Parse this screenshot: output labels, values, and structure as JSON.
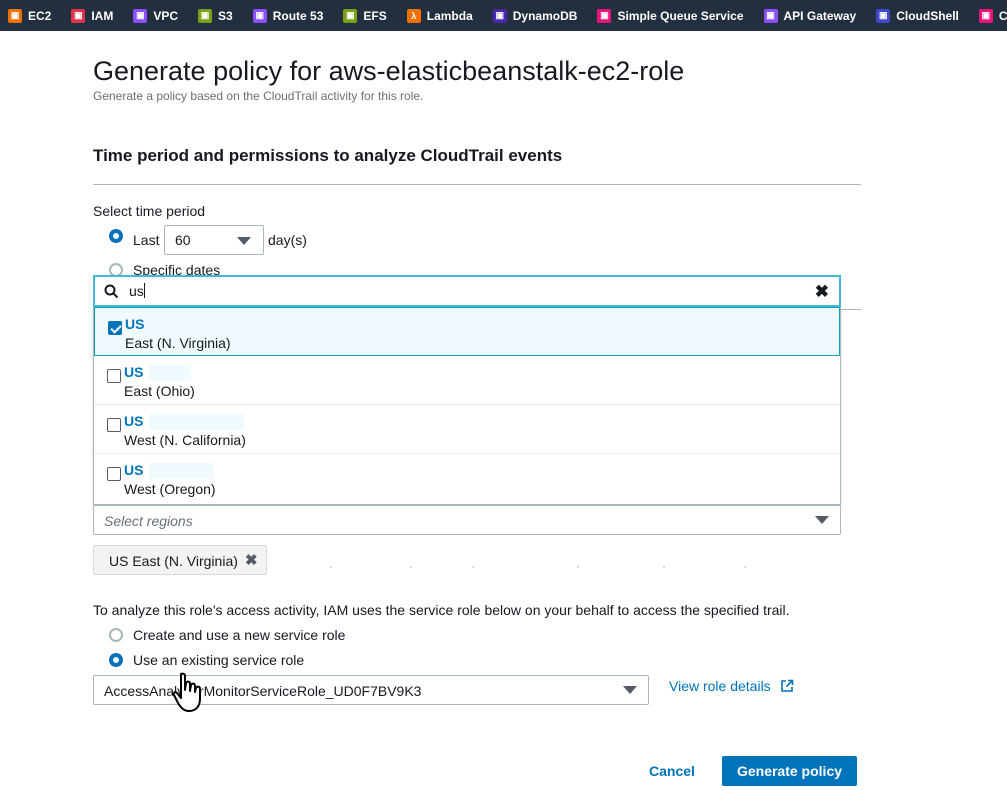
{
  "favorites": [
    {
      "label": "EC2",
      "icon": "ec2-icon",
      "color": "#ed7100"
    },
    {
      "label": "IAM",
      "icon": "iam-icon",
      "color": "#dd344c"
    },
    {
      "label": "VPC",
      "icon": "vpc-icon",
      "color": "#8c4fff"
    },
    {
      "label": "S3",
      "icon": "s3-icon",
      "color": "#7aa116"
    },
    {
      "label": "Route 53",
      "icon": "route53-icon",
      "color": "#8c4fff"
    },
    {
      "label": "EFS",
      "icon": "efs-icon",
      "color": "#7aa116"
    },
    {
      "label": "Lambda",
      "icon": "lambda-icon",
      "color": "#ed7100"
    },
    {
      "label": "DynamoDB",
      "icon": "dynamodb-icon",
      "color": "#4d27aa"
    },
    {
      "label": "Simple Queue Service",
      "icon": "sqs-icon",
      "color": "#e7157b"
    },
    {
      "label": "API Gateway",
      "icon": "api-gateway-icon",
      "color": "#8c4fff"
    },
    {
      "label": "CloudShell",
      "icon": "cloudshell-icon",
      "color": "#3f48cc"
    },
    {
      "label": "CloudFor",
      "icon": "cloudformation-icon",
      "color": "#e7157b"
    }
  ],
  "page": {
    "title": "Generate policy for aws-elasticbeanstalk-ec2-role",
    "subtitle": "Generate a policy based on the CloudTrail activity for this role."
  },
  "section": {
    "title": "Time period and permissions to analyze CloudTrail events",
    "time_period_label": "Select time period",
    "last_label": "Last",
    "days_value": "60",
    "days_suffix": "day(s)",
    "specific_dates_label": "Specific dates"
  },
  "region_search": {
    "query": "us",
    "options": [
      {
        "code": "US",
        "name": "East (N. Virginia)",
        "checked": true
      },
      {
        "code": "US",
        "name": "East (Ohio)",
        "checked": false
      },
      {
        "code": "US",
        "name": "West (N. California)",
        "checked": false
      },
      {
        "code": "US",
        "name": "West (Oregon)",
        "checked": false
      }
    ],
    "placeholder": "Select regions",
    "selected_token": "US East (N. Virginia)"
  },
  "service_role": {
    "description": "To analyze this role's access activity, IAM uses the service role below on your behalf to access the specified trail.",
    "option_new": "Create and use a new service role",
    "option_existing": "Use an existing service role",
    "selected_role": "AccessAnalyzerMonitorServiceRole_UD0F7BV9K3",
    "view_details": "View role details"
  },
  "actions": {
    "cancel": "Cancel",
    "generate": "Generate policy"
  },
  "colors": {
    "accent": "#0073bb",
    "focus": "#44b9d6",
    "topbar": "#232f3e"
  }
}
